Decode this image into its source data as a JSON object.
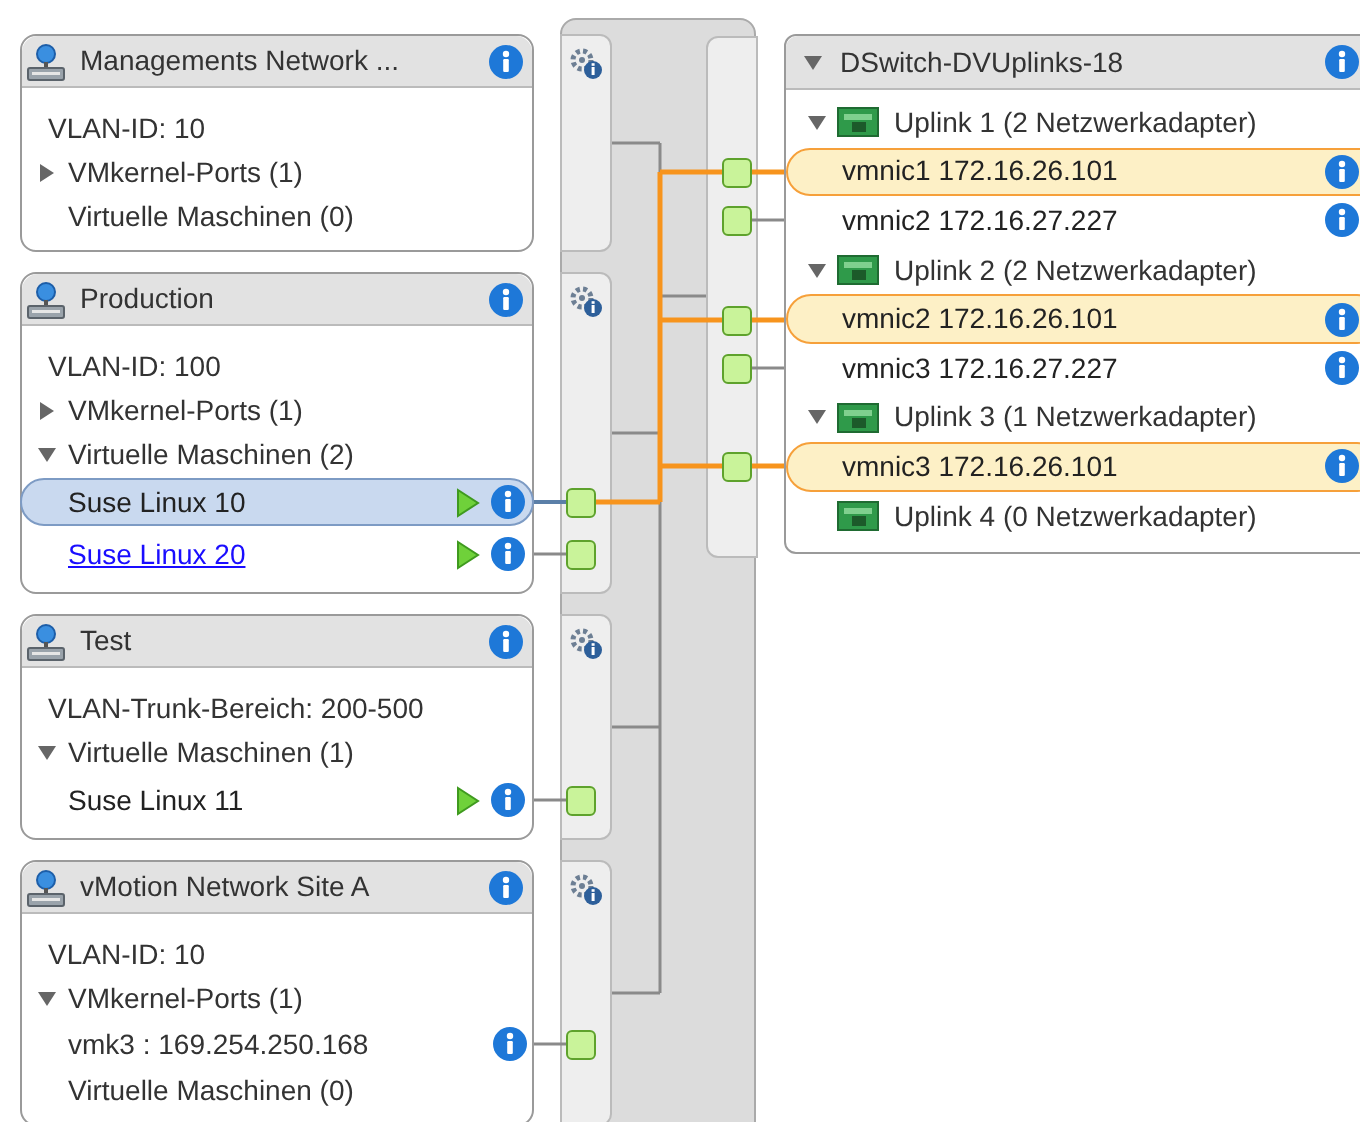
{
  "port_groups": [
    {
      "title": "Managements Network ...",
      "items": [
        {
          "kind": "field",
          "text": "VLAN-ID: 10"
        },
        {
          "kind": "section",
          "text": "VMkernel-Ports (1)",
          "expanded": false
        },
        {
          "kind": "label",
          "text": "Virtuelle Maschinen (0)"
        }
      ]
    },
    {
      "title": "Production",
      "items": [
        {
          "kind": "field",
          "text": "VLAN-ID: 100"
        },
        {
          "kind": "section",
          "text": "VMkernel-Ports (1)",
          "expanded": false
        },
        {
          "kind": "section",
          "text": "Virtuelle Maschinen (2)",
          "expanded": true
        },
        {
          "kind": "vm",
          "text": "Suse Linux 10",
          "selected": true,
          "link": false
        },
        {
          "kind": "vm",
          "text": "Suse Linux 20",
          "selected": false,
          "link": true
        }
      ]
    },
    {
      "title": "Test",
      "items": [
        {
          "kind": "field",
          "text": "VLAN-Trunk-Bereich: 200-500"
        },
        {
          "kind": "section",
          "text": "Virtuelle Maschinen (1)",
          "expanded": true
        },
        {
          "kind": "vm",
          "text": "Suse Linux 11",
          "selected": false,
          "link": false
        }
      ]
    },
    {
      "title": "vMotion Network Site A",
      "items": [
        {
          "kind": "field",
          "text": "VLAN-ID: 10"
        },
        {
          "kind": "section",
          "text": "VMkernel-Ports (1)",
          "expanded": true
        },
        {
          "kind": "vmk",
          "text": "vmk3 : 169.254.250.168"
        },
        {
          "kind": "label",
          "text": "Virtuelle Maschinen (0)"
        }
      ]
    }
  ],
  "uplink_group": {
    "title": "DSwitch-DVUplinks-18",
    "expanded": true,
    "uplinks": [
      {
        "label": "Uplink 1 (2 Netzwerkadapter)",
        "expanded": true,
        "adapters": [
          {
            "name": "vmnic1 172.16.26.101",
            "selected": true
          },
          {
            "name": "vmnic2 172.16.27.227",
            "selected": false
          }
        ]
      },
      {
        "label": "Uplink 2 (2 Netzwerkadapter)",
        "expanded": true,
        "adapters": [
          {
            "name": "vmnic2 172.16.26.101",
            "selected": true
          },
          {
            "name": "vmnic3 172.16.27.227",
            "selected": false
          }
        ]
      },
      {
        "label": "Uplink 3 (1 Netzwerkadapter)",
        "expanded": true,
        "adapters": [
          {
            "name": "vmnic3 172.16.26.101",
            "selected": true
          }
        ]
      },
      {
        "label": "Uplink 4 (0 Netzwerkadapter)"
      }
    ]
  }
}
